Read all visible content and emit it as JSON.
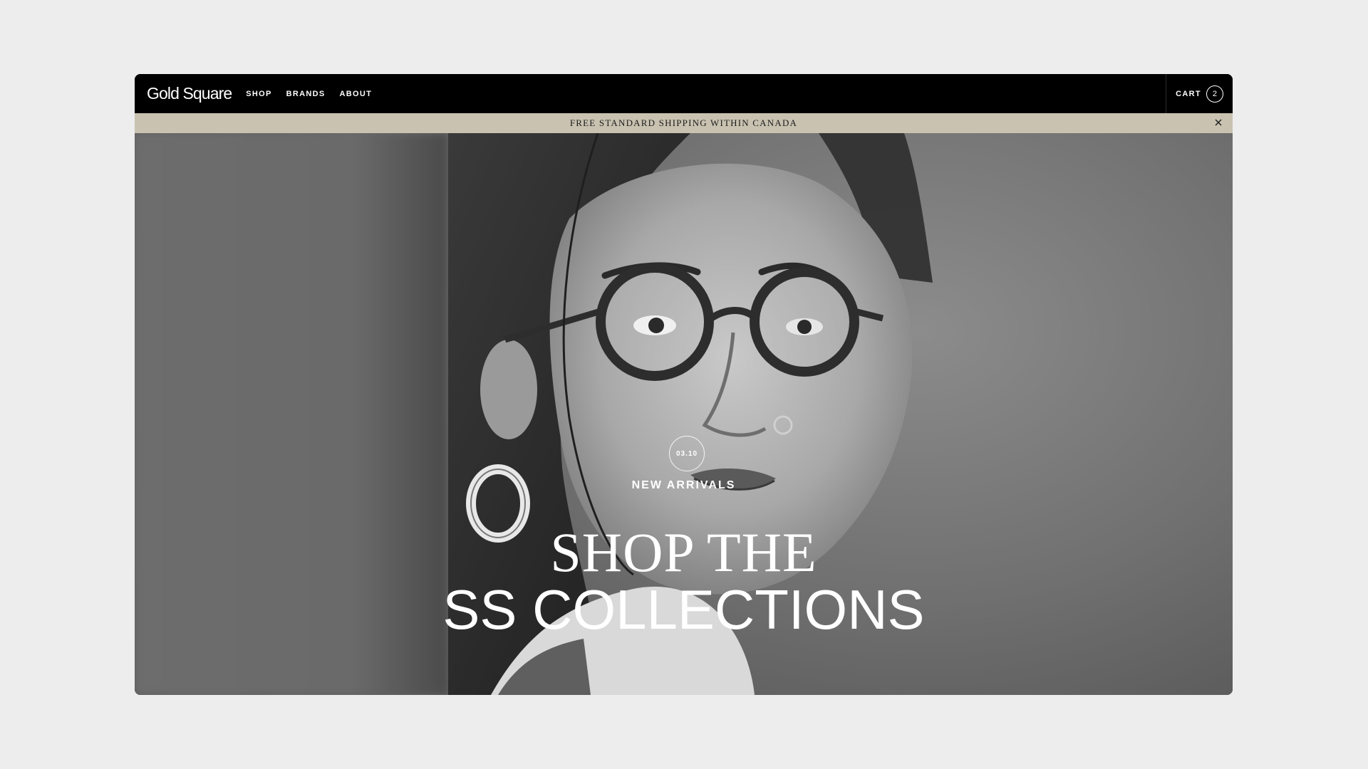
{
  "header": {
    "logo": "Gold Square",
    "nav": [
      {
        "label": "SHOP"
      },
      {
        "label": "BRANDS"
      },
      {
        "label": "ABOUT"
      }
    ],
    "cart": {
      "label": "CART",
      "count": "2"
    }
  },
  "announcement": {
    "text": "FREE STANDARD SHIPPING WITHIN CANADA",
    "close_icon": "close-icon"
  },
  "hero": {
    "date": "03.10",
    "eyebrow": "NEW ARRIVALS",
    "headline_line1": "SHOP THE",
    "headline_line2": "SS COLLECTIONS",
    "image": "portrait-photo"
  },
  "colors": {
    "page_bg": "#ededed",
    "header_bg": "#000000",
    "announce_bg": "#c9c2b1",
    "text_light": "#ffffff"
  }
}
